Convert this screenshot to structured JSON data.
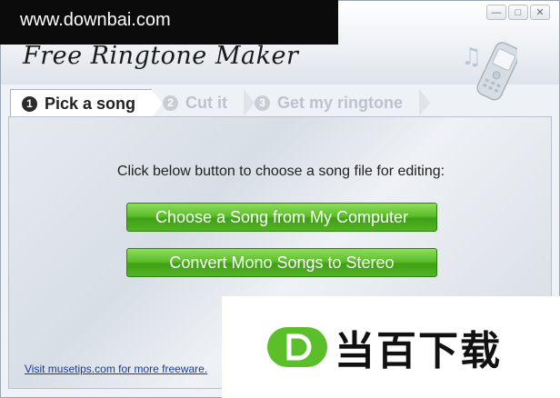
{
  "watermark": {
    "top_text": "www.downbai.com",
    "bottom_text": "当百下载"
  },
  "window": {
    "title": "Free Ringtone Maker",
    "controls": {
      "minimize": "—",
      "maximize": "□",
      "close": "✕"
    }
  },
  "tabs": [
    {
      "number": "1",
      "label": "Pick a song",
      "active": true
    },
    {
      "number": "2",
      "label": "Cut it",
      "active": false
    },
    {
      "number": "3",
      "label": "Get my ringtone",
      "active": false
    }
  ],
  "main": {
    "prompt": "Click below button to choose a song file for editing:",
    "choose_button": "Choose a Song from My Computer",
    "convert_button": "Convert Mono Songs to Stereo",
    "footer_link": "Visit musetips.com for more freeware."
  },
  "icons": {
    "app": "phone-music-icon",
    "logo": "downbai-d-logo-icon"
  },
  "colors": {
    "button_green": "#4caf1e",
    "logo_green": "#5bbf2a",
    "link_blue": "#1a3a9a"
  }
}
